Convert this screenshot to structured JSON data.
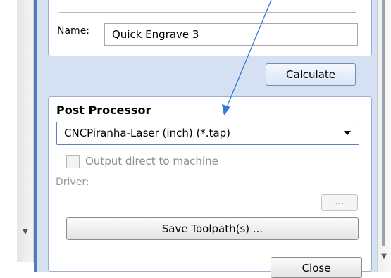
{
  "name_field": {
    "label": "Name:",
    "value": "Quick Engrave 3"
  },
  "calculate_button": {
    "label": "Calculate"
  },
  "post_processor": {
    "title": "Post Processor",
    "selected": "CNCPiranha-Laser (inch) (*.tap)",
    "output_direct_label": "Output direct to machine",
    "output_direct_checked": false,
    "driver_label": "Driver:",
    "browse_label": "...",
    "save_button_label": "Save Toolpath(s) ..."
  },
  "close_button": {
    "label": "Close"
  },
  "scroll": {
    "down_arrow": "▼"
  },
  "colors": {
    "panel_background": "#d5e1f2",
    "annotation_arrow": "#2f7ad6",
    "accent_border": "#5c83c2"
  },
  "icons": [
    "chevron-down-icon",
    "annotation-arrow"
  ]
}
